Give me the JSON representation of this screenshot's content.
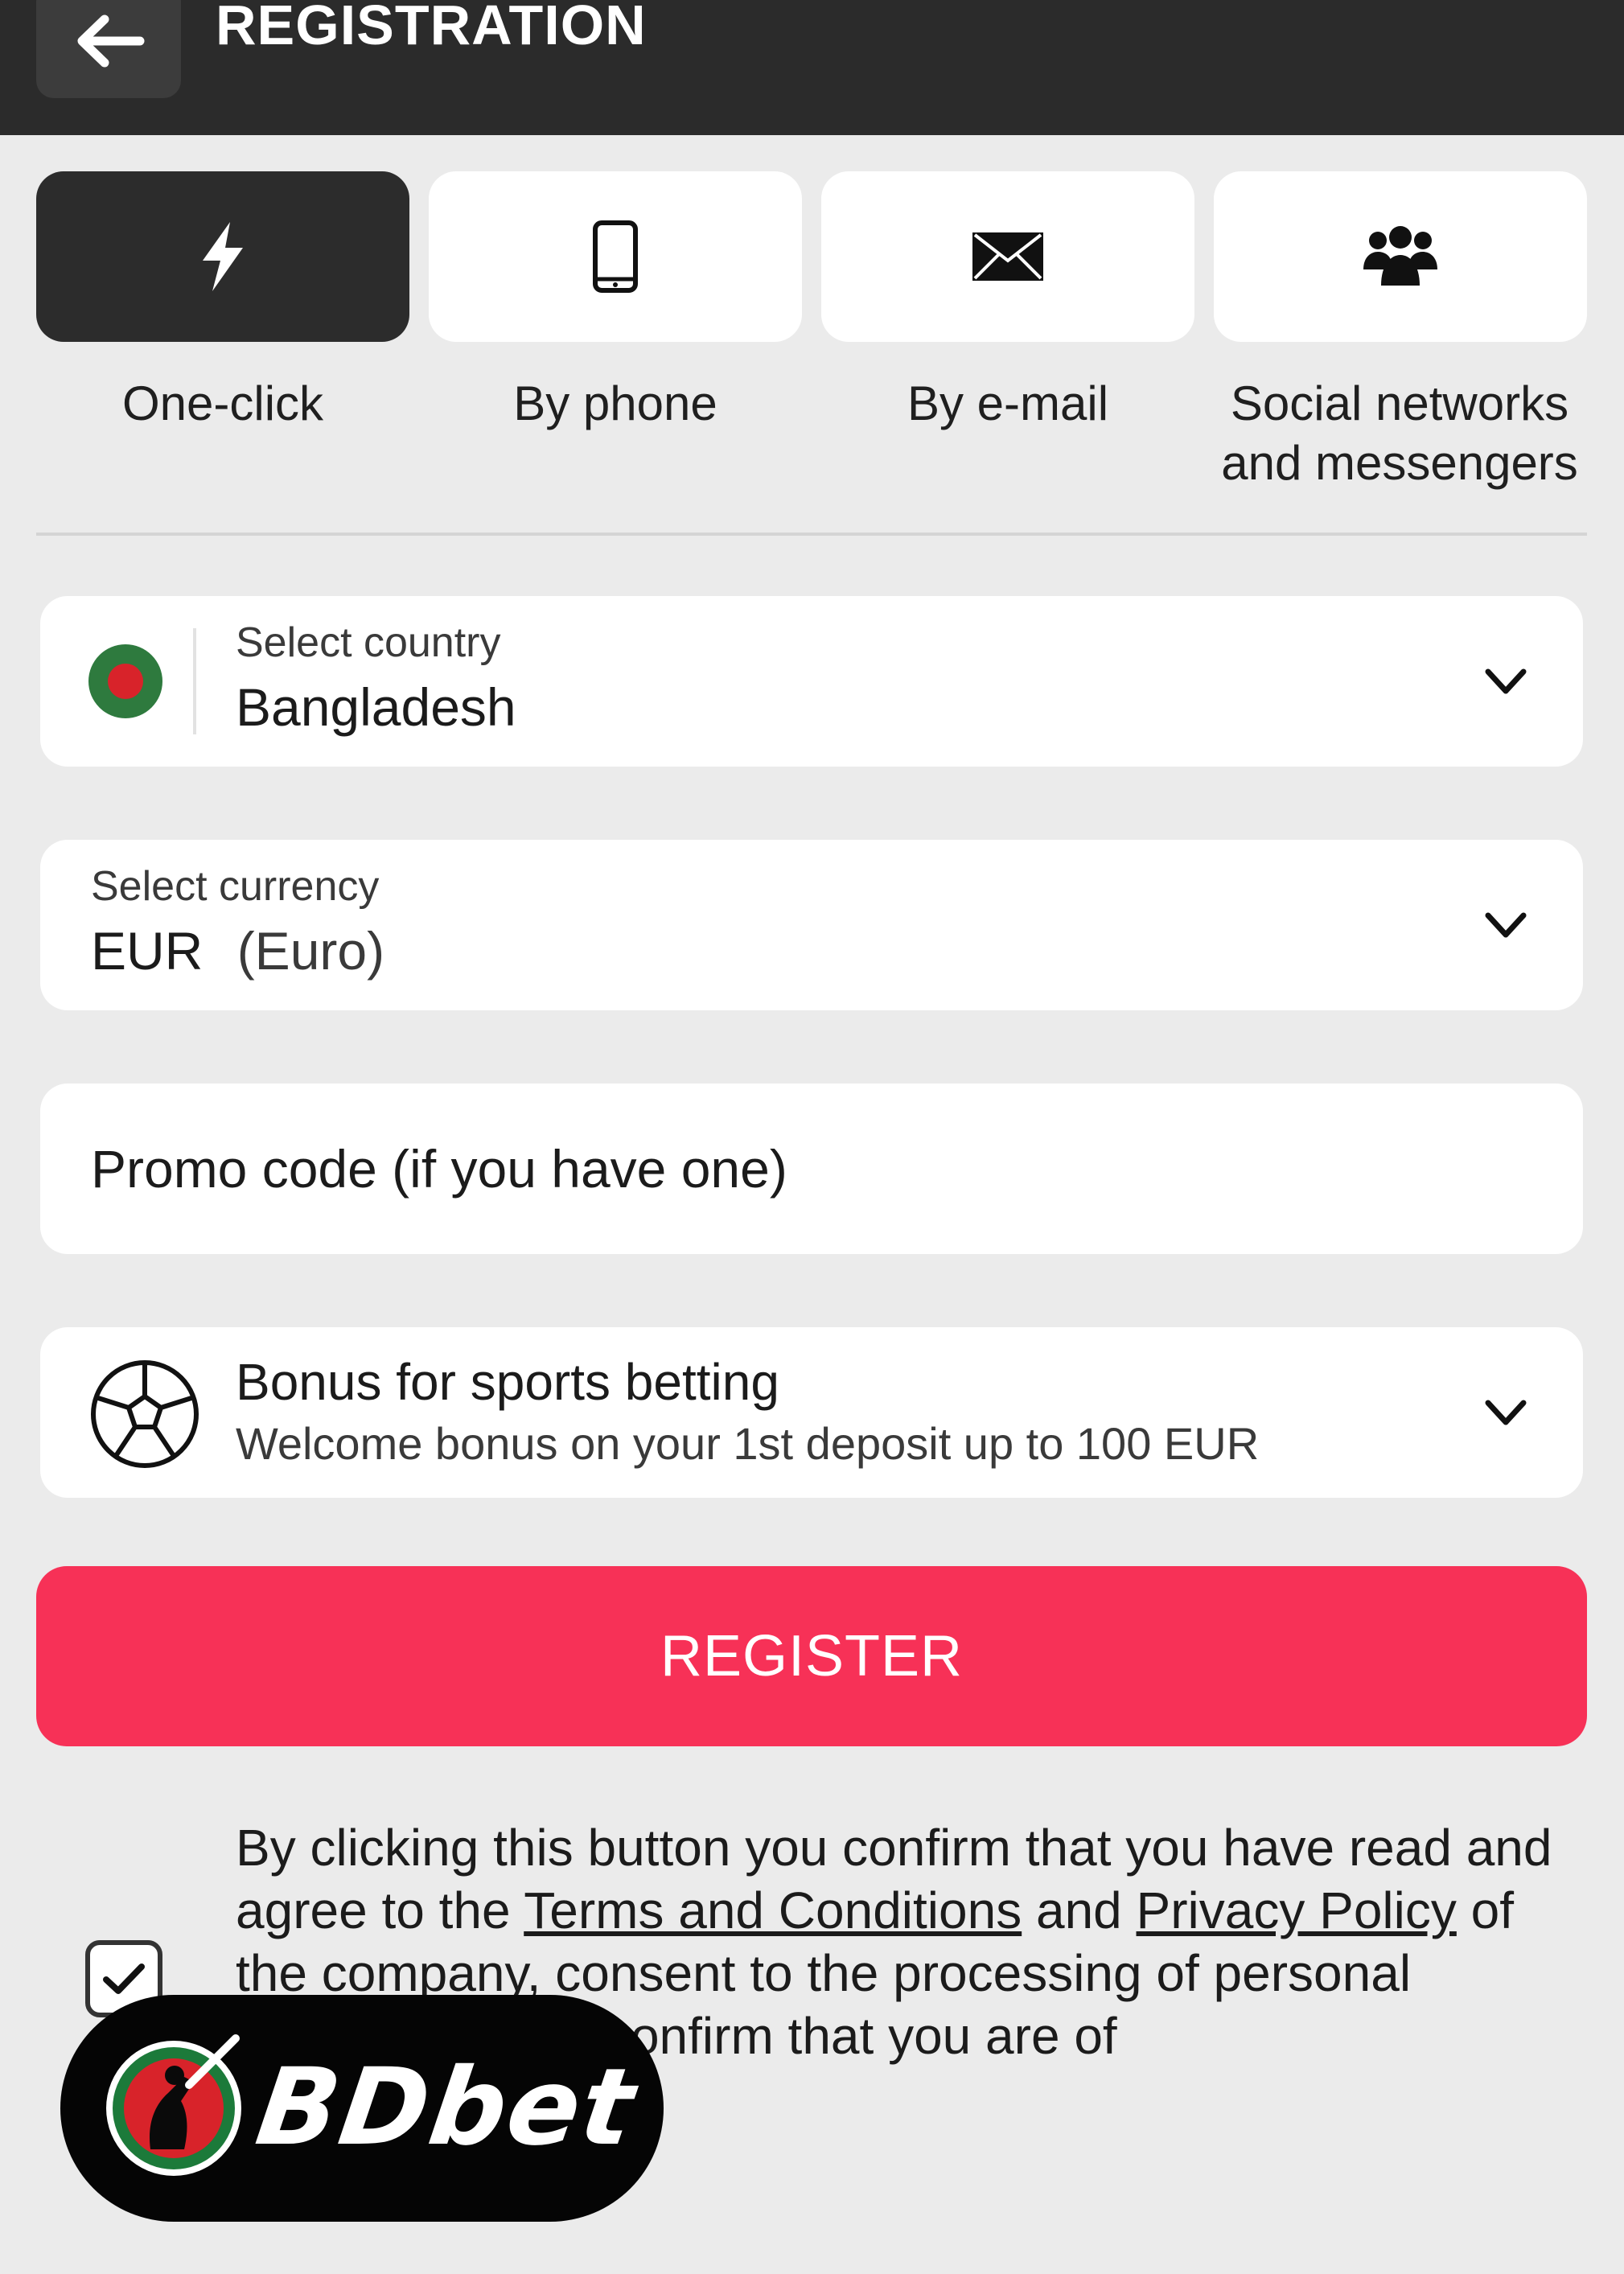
{
  "header": {
    "title": "REGISTRATION"
  },
  "methods": [
    {
      "label": "One-click",
      "icon": "lightning-icon",
      "active": true
    },
    {
      "label": "By phone",
      "icon": "phone-icon",
      "active": false
    },
    {
      "label": "By e-mail",
      "icon": "envelope-icon",
      "active": false
    },
    {
      "label": "Social networks\nand messengers",
      "icon": "users-group-icon",
      "active": false
    }
  ],
  "country": {
    "label": "Select country",
    "value": "Bangladesh",
    "flag_colors": {
      "field": "#2e7a3e",
      "disc": "#d8232a"
    }
  },
  "currency": {
    "label": "Select currency",
    "code": "EUR",
    "name": "(Euro)"
  },
  "promo": {
    "placeholder": "Promo code (if you have one)"
  },
  "bonus": {
    "title": "Bonus for sports betting",
    "description": "Welcome bonus on your 1st deposit up to 100 EUR",
    "icon": "soccer-ball-icon"
  },
  "register": {
    "label": "REGISTER",
    "color": "#f73157"
  },
  "consent": {
    "checked": true,
    "text_1": "By clicking this button you confirm that you have read and agree to the ",
    "terms_link": "Terms and Conditions",
    "text_2": " and ",
    "privacy_link": "Privacy Policy",
    "text_3": " of the company, consent to the processing of personal information and confirm that you are of"
  },
  "watermark": {
    "brand": "BDbet"
  },
  "colors": {
    "header_bg": "#2b2b2b",
    "page_bg": "#ebebeb",
    "active_tab": "#2c2c2c",
    "accent": "#f73157"
  }
}
